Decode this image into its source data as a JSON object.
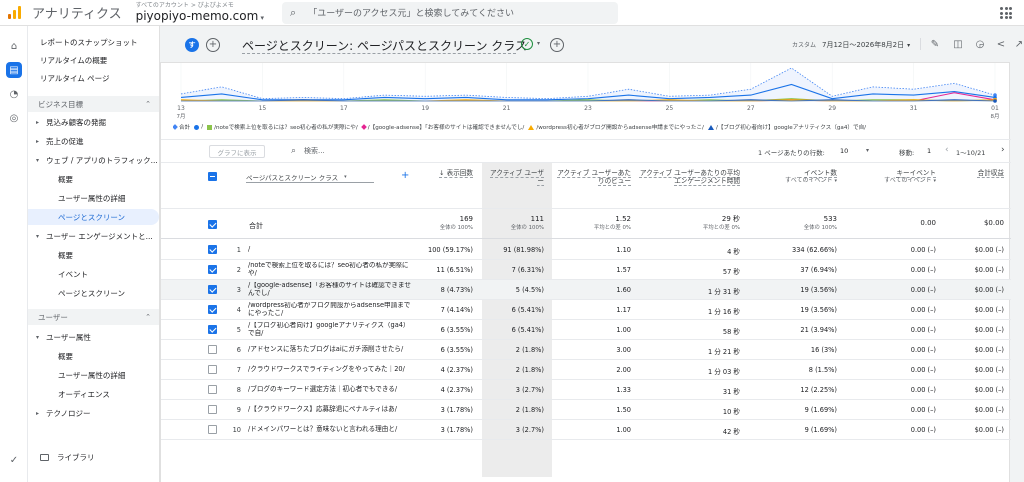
{
  "topbar": {
    "app_title": "アナリティクス",
    "account_crumb": "すべてのアカウント > ぴよぴよメモ",
    "property": "piyopiyo-memo.com",
    "search_placeholder": "「ユーザーのアクセス元」と検索してみてください"
  },
  "sidebar": {
    "items": [
      {
        "label": "レポートのスナップショット",
        "kind": "top"
      },
      {
        "label": "リアルタイムの概要",
        "kind": "top"
      },
      {
        "label": "リアルタイム ページ",
        "kind": "top"
      },
      {
        "label": "ビジネス目標",
        "kind": "section"
      },
      {
        "label": "見込み顧客の発掘",
        "kind": "l1",
        "arrow": "▸"
      },
      {
        "label": "売上の促進",
        "kind": "l1",
        "arrow": "▸"
      },
      {
        "label": "ウェブ / アプリのトラフィック...",
        "kind": "l1",
        "arrow": "▾"
      },
      {
        "label": "概要",
        "kind": "l2"
      },
      {
        "label": "ユーザー属性の詳細",
        "kind": "l2"
      },
      {
        "label": "ページとスクリーン",
        "kind": "l2",
        "selected": true
      },
      {
        "label": "ユーザー エンゲージメントと...",
        "kind": "l1",
        "arrow": "▾"
      },
      {
        "label": "概要",
        "kind": "l2"
      },
      {
        "label": "イベント",
        "kind": "l2"
      },
      {
        "label": "ページとスクリーン",
        "kind": "l2"
      },
      {
        "label": "ユーザー",
        "kind": "section"
      },
      {
        "label": "ユーザー属性",
        "kind": "l1",
        "arrow": "▾"
      },
      {
        "label": "概要",
        "kind": "l2"
      },
      {
        "label": "ユーザー属性の詳細",
        "kind": "l2"
      },
      {
        "label": "オーディエンス",
        "kind": "l2"
      },
      {
        "label": "テクノロジー",
        "kind": "l1",
        "arrow": "▸"
      }
    ],
    "library": "ライブラリ"
  },
  "header": {
    "avatar": "す",
    "title": "ページとスクリーン: ページパスとスクリーン クラス",
    "date_label": "カスタム",
    "date_range": "7月12日〜2026年8月2日"
  },
  "chart_data": {
    "type": "line",
    "x": [
      "7/13",
      "7/14",
      "7/15",
      "7/16",
      "7/17",
      "7/18",
      "7/19",
      "7/20",
      "7/21",
      "7/22",
      "7/23",
      "7/24",
      "7/25",
      "7/26",
      "7/27",
      "7/28",
      "7/29",
      "7/30",
      "7/31",
      "8/1",
      "8/2"
    ],
    "tick_labels": [
      "13",
      "15",
      "17",
      "19",
      "21",
      "23",
      "25",
      "27",
      "29",
      "31",
      "01"
    ],
    "tick_sublabels": {
      "13": "7月",
      "01": "8月"
    },
    "series": [
      {
        "name": "合計",
        "color": "#4285f4",
        "values": [
          6,
          12,
          2,
          3,
          2,
          5,
          4,
          5,
          3,
          2,
          4,
          10,
          4,
          5,
          10,
          28,
          4,
          12,
          10,
          15,
          5
        ]
      },
      {
        "name": "/",
        "color": "#1a73e8",
        "values": [
          3,
          6,
          1,
          1,
          1,
          3,
          2,
          3,
          1,
          1,
          2,
          5,
          2,
          3,
          5,
          14,
          2,
          6,
          5,
          8,
          3
        ]
      },
      {
        "name": "/noteで検索上位を取るには？seo初心者の私が実際にや/",
        "color": "#8bc34a",
        "values": [
          0,
          1,
          0,
          0,
          0,
          1,
          0,
          0,
          0,
          0,
          1,
          0,
          0,
          1,
          0,
          2,
          0,
          1,
          1,
          0,
          1
        ]
      },
      {
        "name": "/【google-adsense】「お客様のサイトは確認できませんでし/",
        "color": "#e52592",
        "values": [
          0,
          0,
          0,
          0,
          0,
          0,
          0,
          0,
          0,
          0,
          0,
          0,
          0,
          0,
          0,
          1,
          0,
          0,
          0,
          7,
          1
        ]
      },
      {
        "name": "/wordpress初心者がブログ開設からadsense申請までにやったこ/",
        "color": "#f9ab00",
        "values": [
          1,
          0,
          0,
          0,
          0,
          0,
          0,
          1,
          0,
          0,
          0,
          0,
          1,
          0,
          0,
          1,
          0,
          0,
          1,
          0,
          1
        ]
      },
      {
        "name": "/【ブログ初心者向け】googleアナリティクス（ga4）で自/",
        "color": "#185abc",
        "values": [
          0,
          0,
          0,
          1,
          0,
          0,
          0,
          0,
          0,
          0,
          0,
          1,
          0,
          0,
          1,
          0,
          1,
          0,
          0,
          1,
          0
        ]
      }
    ],
    "legend_prefix": "合計",
    "legend_labels": [
      "/",
      "/noteで検索上位を取るには？seo初心者の私が実際にや/",
      "/【google-adsense】「お客様のサイトは確認できませんでし/",
      "/wordpress初心者がブログ開設からadsense申請までにやったこ/",
      "/【ブログ初心者向け】googleアナリティクス（ga4）で自/"
    ]
  },
  "toolbar": {
    "graph_button": "グラフに表示",
    "search_placeholder": "検索...",
    "rows_per_page_label": "1 ページあたりの行数:",
    "rows_per_page": "10",
    "goto_label": "移動:",
    "goto_value": "1",
    "page_range": "1〜10/21"
  },
  "table": {
    "dimension": "ページパスとスクリーン クラス",
    "columns": [
      {
        "label": "↓ 表示回数",
        "sub": ""
      },
      {
        "label": "アクティブ ユーザー",
        "sub": ""
      },
      {
        "label": "アクティブ ユーザーあたりのビュー",
        "sub": ""
      },
      {
        "label": "アクティブ ユーザーあたりの平均エンゲージメント時間",
        "sub": ""
      },
      {
        "label": "イベント数",
        "sub": "すべてのイベント"
      },
      {
        "label": "キーイベント",
        "sub": "すべてのイベント"
      },
      {
        "label": "合計収益",
        "sub": ""
      }
    ],
    "total": {
      "label": "合計",
      "values": [
        "169",
        "111",
        "1.52",
        "29 秒",
        "533",
        "0.00",
        "$0.00"
      ],
      "subs": [
        "全体の 100%",
        "全体の 100%",
        "平均との差 0%",
        "平均との差 0%",
        "全体の 100%",
        "",
        ""
      ]
    },
    "rows": [
      {
        "n": "1",
        "page": "/",
        "values": [
          "100 (59.17%)",
          "91 (81.98%)",
          "1.10",
          "4 秒",
          "334 (62.66%)",
          "0.00 (–)",
          "$0.00 (–)"
        ],
        "checked": true
      },
      {
        "n": "2",
        "page": "/noteで検索上位を取るには？seo初心者の私が実際にや/",
        "values": [
          "11 (6.51%)",
          "7 (6.31%)",
          "1.57",
          "57 秒",
          "37 (6.94%)",
          "0.00 (–)",
          "$0.00 (–)"
        ],
        "checked": true
      },
      {
        "n": "3",
        "page": "/【google-adsense】「お客様のサイトは確認できませんでし/",
        "values": [
          "8 (4.73%)",
          "5 (4.5%)",
          "1.60",
          "1 分 31 秒",
          "19 (3.56%)",
          "0.00 (–)",
          "$0.00 (–)"
        ],
        "checked": true,
        "highlight": true
      },
      {
        "n": "4",
        "page": "/wordpress初心者がブログ開設からadsense申請までにやったこ/",
        "values": [
          "7 (4.14%)",
          "6 (5.41%)",
          "1.17",
          "1 分 16 秒",
          "19 (3.56%)",
          "0.00 (–)",
          "$0.00 (–)"
        ],
        "checked": true
      },
      {
        "n": "5",
        "page": "/【ブログ初心者向け】googleアナリティクス（ga4）で自/",
        "values": [
          "6 (3.55%)",
          "6 (5.41%)",
          "1.00",
          "58 秒",
          "21 (3.94%)",
          "0.00 (–)",
          "$0.00 (–)"
        ],
        "checked": true
      },
      {
        "n": "6",
        "page": "/アドセンスに落ちたブログはaiにガチ添削させたら/",
        "values": [
          "6 (3.55%)",
          "2 (1.8%)",
          "3.00",
          "1 分 21 秒",
          "16 (3%)",
          "0.00 (–)",
          "$0.00 (–)"
        ],
        "checked": false
      },
      {
        "n": "7",
        "page": "/クラウドワークスでライティングをやってみた｜20/",
        "values": [
          "4 (2.37%)",
          "2 (1.8%)",
          "2.00",
          "1 分 03 秒",
          "8 (1.5%)",
          "0.00 (–)",
          "$0.00 (–)"
        ],
        "checked": false
      },
      {
        "n": "8",
        "page": "/ブログのキーワード選定方法｜初心者でもできる/",
        "values": [
          "4 (2.37%)",
          "3 (2.7%)",
          "1.33",
          "31 秒",
          "12 (2.25%)",
          "0.00 (–)",
          "$0.00 (–)"
        ],
        "checked": false
      },
      {
        "n": "9",
        "page": "/【クラウドワークス】応募辞退にペナルティはあ/",
        "values": [
          "3 (1.78%)",
          "2 (1.8%)",
          "1.50",
          "10 秒",
          "9 (1.69%)",
          "0.00 (–)",
          "$0.00 (–)"
        ],
        "checked": false
      },
      {
        "n": "10",
        "page": "/ドメインパワーとは？意味ないと言われる理由と/",
        "values": [
          "3 (1.78%)",
          "3 (2.7%)",
          "1.00",
          "42 秒",
          "9 (1.69%)",
          "0.00 (–)",
          "$0.00 (–)"
        ],
        "checked": false
      }
    ]
  }
}
